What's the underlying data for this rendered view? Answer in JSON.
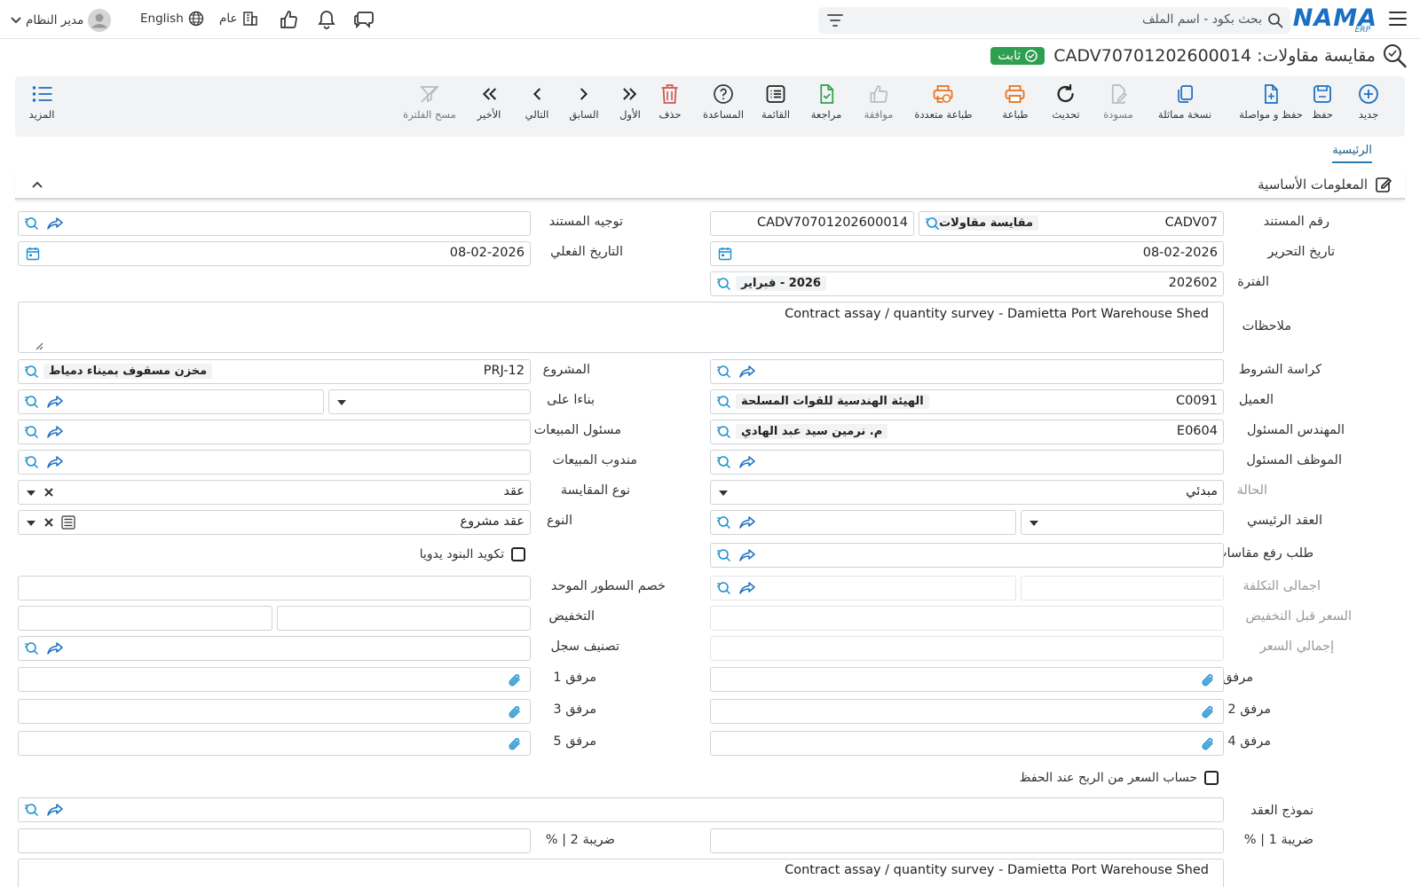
{
  "topbar": {
    "logo_text": "NAMA",
    "logo_sub": "ERP",
    "search_placeholder": "بحث بكود - اسم الملف",
    "user_name": "مدير النظام",
    "language": "English",
    "company": "عام"
  },
  "title": {
    "text": "مقايسة مقاولات: CADV70701202600014",
    "status_badge": "ثابت"
  },
  "toolbar": {
    "new": "جديد",
    "save": "حفظ",
    "save_continue": "حفظ و مواصلة",
    "duplicate": "نسخة مماثلة",
    "draft": "مسودة",
    "refresh": "تحديث",
    "print": "طباعة",
    "multi_print": "طباعة متعددة",
    "approve": "موافقة",
    "review": "مراجعة",
    "list": "القائمة",
    "help": "المساعدة",
    "delete": "حذف",
    "first": "الأول",
    "previous": "السابق",
    "next": "التالي",
    "last": "الأخير",
    "clear_filter": "مسح الفلترة",
    "more": "المزيد"
  },
  "tabs": {
    "main": "الرئيسية"
  },
  "section": {
    "title": "المعلومات الأساسية"
  },
  "labels": {
    "doc_number": "رقم المستند",
    "doc_direction": "توجيه المستند",
    "edit_date": "تاريخ التحرير",
    "actual_date": "التاريخ الفعلي",
    "period": "الفترة",
    "notes": "ملاحظات",
    "terms_book": "كراسة الشروط",
    "project": "المشروع",
    "customer": "العميل",
    "based_on": "بناءا على",
    "engineer": "المهندس المسئول",
    "sales_officer": "مسئول المبيعات",
    "responsible_employee": "الموظف المسئول",
    "sales_rep": "مندوب المبيعات",
    "status": "الحالة",
    "assay_type": "نوع المقايسة",
    "main_contract": "العقد الرئيسي",
    "type": "النوع",
    "invoice_request": "طلب رفع مقاسات",
    "manual_items": "تكويد البنود يدويا",
    "total_cost": "اجمالى التكلفة",
    "unified_discount": "خصم السطور الموحد",
    "price_before_discount": "السعر قبل التخفيض",
    "discount": "التخفيض",
    "total_price": "إجمالي السعر",
    "record_class": "تصنيف سجل",
    "attachment": "مرفق",
    "attachment1": "مرفق 1",
    "attachment2": "مرفق 2",
    "attachment3": "مرفق 3",
    "attachment4": "مرفق 4",
    "attachment5": "مرفق 5",
    "calc_price_profit": "حساب السعر من الربح عند الحفظ",
    "contract_template": "نموذج العقد",
    "tax1": "ضريبة 1 | %",
    "tax2": "ضريبة 2 | %"
  },
  "values": {
    "doc_code": "CADV07",
    "doc_type_name": "مقايسة مقاولات",
    "doc_full_number": "CADV70701202600014",
    "edit_date": "08-02-2026",
    "actual_date": "08-02-2026",
    "period_code": "202602",
    "period_name": "2026 - فبراير",
    "notes": "Contract assay / quantity survey - Damietta Port Warehouse Shed",
    "project_code": "PRJ-12",
    "project_name": "مخزن مسقوف بميناء دمياط",
    "customer_code": "C0091",
    "customer_name": "الهيئة الهندسية للقوات المسلحة",
    "engineer_code": "E0604",
    "engineer_name": "م. نرمين سيد عبد الهادي",
    "status": "مبدئي",
    "assay_type": "عقد",
    "type": "عقد مشروع",
    "notes2": "Contract assay / quantity survey - Damietta Port Warehouse Shed"
  },
  "colors": {
    "accent": "#1a6fc2",
    "badge": "#2e9e4f",
    "print": "#e8731c",
    "review": "#2e9e4f",
    "delete": "#d9534f"
  }
}
